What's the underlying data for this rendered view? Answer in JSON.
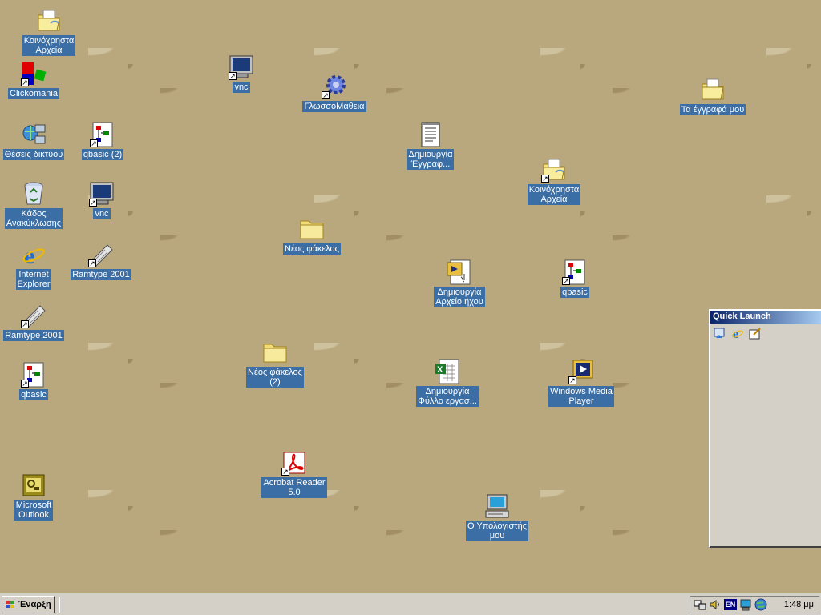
{
  "desktop_icons": [
    {
      "id": "shared-files-1",
      "label": "Κοινόχρηστα\nΑρχεία",
      "icon": "shared-folder-icon",
      "shortcut": false
    },
    {
      "id": "clickomania",
      "label": "Clickomania",
      "icon": "clickomania-icon",
      "shortcut": true
    },
    {
      "id": "network-places",
      "label": "Θέσεις δικτύου",
      "icon": "network-places-icon",
      "shortcut": false
    },
    {
      "id": "qbasic-2",
      "label": "qbasic (2)",
      "icon": "qbasic-icon",
      "shortcut": true
    },
    {
      "id": "recycle-bin",
      "label": "Κάδος\nΑνακύκλωσης",
      "icon": "recycle-bin-icon",
      "shortcut": false
    },
    {
      "id": "vnc-1",
      "label": "vnc",
      "icon": "vnc-icon",
      "shortcut": true
    },
    {
      "id": "internet-explorer",
      "label": "Internet\nExplorer",
      "icon": "internet-explorer-icon",
      "shortcut": false
    },
    {
      "id": "ramtype-1",
      "label": "Ramtype 2001",
      "icon": "keyboard-icon",
      "shortcut": true
    },
    {
      "id": "ramtype-2",
      "label": "Ramtype 2001",
      "icon": "keyboard-icon",
      "shortcut": true
    },
    {
      "id": "qbasic-1",
      "label": "qbasic",
      "icon": "qbasic-icon",
      "shortcut": true
    },
    {
      "id": "outlook",
      "label": "Microsoft\nOutlook",
      "icon": "outlook-icon",
      "shortcut": false
    },
    {
      "id": "vnc-2",
      "label": "vnc",
      "icon": "vnc-icon",
      "shortcut": true
    },
    {
      "id": "glossomatheia",
      "label": "ΓλωσσοΜάθεια",
      "icon": "gear-icon",
      "shortcut": true
    },
    {
      "id": "new-folder-1",
      "label": "Νέος φάκελος",
      "icon": "folder-icon",
      "shortcut": false
    },
    {
      "id": "new-folder-2",
      "label": "Νέος φάκελος\n(2)",
      "icon": "folder-icon",
      "shortcut": false
    },
    {
      "id": "acrobat",
      "label": "Acrobat Reader\n5.0",
      "icon": "acrobat-icon",
      "shortcut": true
    },
    {
      "id": "new-document",
      "label": "Δημιουργία\nΈγγραφ...",
      "icon": "document-icon",
      "shortcut": false
    },
    {
      "id": "new-sound",
      "label": "Δημιουργία\nΑρχείο ήχου",
      "icon": "sound-file-icon",
      "shortcut": false
    },
    {
      "id": "new-sheet",
      "label": "Δημιουργία\nΦύλλο εργασ...",
      "icon": "spreadsheet-icon",
      "shortcut": false
    },
    {
      "id": "shared-files-2",
      "label": "Κοινόχρηστα\nΑρχεία",
      "icon": "shared-folder-icon",
      "shortcut": true
    },
    {
      "id": "qbasic-3",
      "label": "qbasic",
      "icon": "qbasic-icon",
      "shortcut": true
    },
    {
      "id": "media-player",
      "label": "Windows Media\nPlayer",
      "icon": "media-player-icon",
      "shortcut": true
    },
    {
      "id": "my-computer",
      "label": "Ο Υπολογιστής\nμου",
      "icon": "my-computer-icon",
      "shortcut": false
    },
    {
      "id": "my-documents",
      "label": "Τα έγγραφά μου",
      "icon": "my-documents-icon",
      "shortcut": false
    }
  ],
  "quick_launch": {
    "title": "Quick Launch",
    "buttons": [
      "show-desktop-icon",
      "internet-explorer-icon",
      "outlook-express-icon"
    ]
  },
  "taskbar": {
    "start_label": "Έναρξη",
    "language": "EN",
    "clock": "1:48 μμ",
    "tray_icons": [
      "network-tray-icon",
      "volume-icon",
      "language-icon",
      "computer-tray-icon",
      "globe-icon"
    ]
  },
  "colors": {
    "desktop": "#b9a87d",
    "label_bg": "#3a6ea5",
    "taskbar": "#d4d0c8",
    "title_start": "#0a246a",
    "title_end": "#a6caf0"
  }
}
